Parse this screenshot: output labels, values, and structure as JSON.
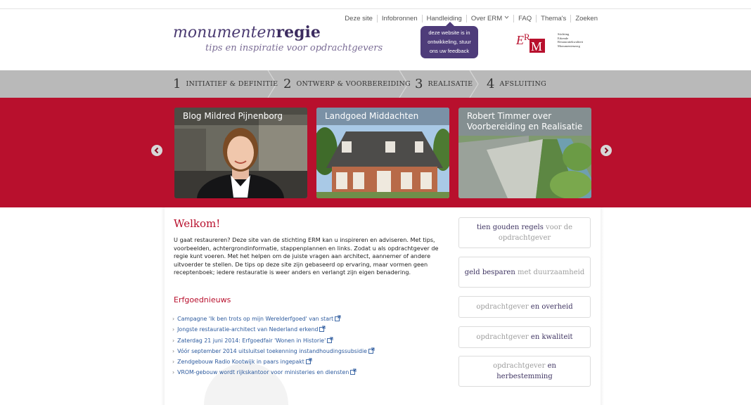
{
  "header": {
    "logo_light": "monumenten",
    "logo_bold": "regie",
    "tagline": "tips en inspiratie voor opdrachtgevers",
    "nav": [
      "Deze site",
      "Infobronnen",
      "Handleiding",
      "Over ERM",
      "FAQ",
      "Thema's",
      "Zoeken"
    ],
    "bubble_lines": [
      "deze website is in",
      "ontwikkeling, stuur",
      "ons uw feedback"
    ],
    "erm_logo_text": [
      "Stichting",
      "Erkende",
      "Restauratiekwaliteit",
      "Monumentenzorg"
    ]
  },
  "steps": [
    {
      "num": "1",
      "label": "INITIATIEF & DEFINITIE"
    },
    {
      "num": "2",
      "label": "ONTWERP & VOORBEREIDING"
    },
    {
      "num": "3",
      "label": "REALISATIE"
    },
    {
      "num": "4",
      "label": "AFSLUITING"
    }
  ],
  "carousel": {
    "slides": [
      {
        "title": "Blog Mildred Pijnenborg"
      },
      {
        "title": "Landgoed Middachten"
      },
      {
        "title": "Robert Timmer over Voorbereiding en Realisatie"
      }
    ]
  },
  "main": {
    "welkom_title": "Welkom!",
    "intro": "U gaat restaureren? Deze site van de stichting ERM kan u inspireren en adviseren. Met tips, voorbeelden, achtergrondinformatie, stappenplannen en links. Zodat u als opdrachtgever de regie kunt voeren. Met het helpen om  de juiste vragen aan architect, aannemer of andere uitvoerder te stellen. De tips op deze site zijn gebaseerd op ervaring, maar vormen geen receptenboek; iedere restauratie is weer anders en verlangt zijn eigen benadering.",
    "erfgoed_title": "Erfgoednieuws",
    "news": [
      "Campagne 'Ik ben trots op mijn Werelderfgoed' van start",
      "Jongste restauratie-architect van Nederland erkend",
      "Zaterdag 21 juni 2014: Erfgoedfair 'Wonen in Historie'",
      "Vóór september 2014 uitsluitsel toekenning instandhoudingssubsidie",
      "Zendgebouw Radio Kootwijk in paars ingepakt",
      "VROM-gebouw wordt rijkskantoor voor ministeries en diensten"
    ]
  },
  "cards": [
    {
      "dark": "tien gouden regels",
      "light": " voor de opdrachtgever"
    },
    {
      "dark": "geld besparen",
      "light": " met duurzaamheid"
    },
    {
      "light": "opdrachtgever ",
      "dark": "en overheid"
    },
    {
      "light": "opdrachtgever ",
      "dark": "en kwaliteit"
    },
    {
      "light": "opdrachtgever ",
      "dark": "en herbestemming"
    }
  ],
  "colors": {
    "accent_red": "#b8102d",
    "brand_purple": "#4e3c7a",
    "steps_bg": "#b9b9b9",
    "link_blue": "#2c5a9e"
  }
}
